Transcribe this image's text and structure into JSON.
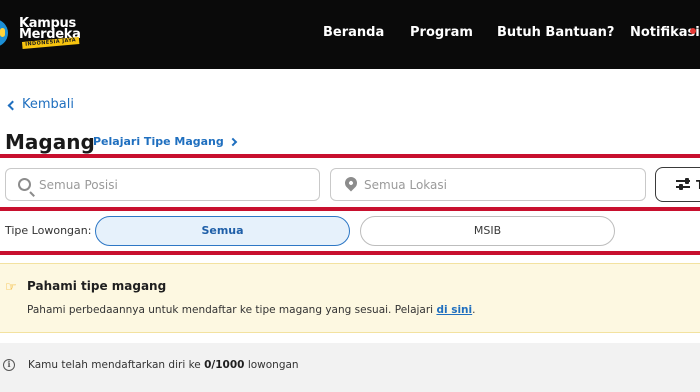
{
  "navbar": {
    "logo_line1": "Kampus",
    "logo_line2": "Merdeka",
    "logo_tagline": "INDONESIA JAYA",
    "items": [
      {
        "label": "Beranda"
      },
      {
        "label": "Program"
      },
      {
        "label": "Butuh Bantuan?"
      },
      {
        "label": "Notifikasi"
      }
    ]
  },
  "header": {
    "back_label": "Kembali",
    "title": "Magang",
    "learn_link": "Pelajari Tipe Magang"
  },
  "search": {
    "position_placeholder": "Semua Posisi",
    "position_value": "",
    "location_placeholder": "Semua Lokasi",
    "location_value": "",
    "filter_label": "T"
  },
  "type_filter": {
    "label": "Tipe Lowongan:",
    "options": [
      {
        "label": "Semua",
        "selected": true
      },
      {
        "label": "MSIB",
        "selected": false
      }
    ]
  },
  "info": {
    "icon": "pointing-hand-icon",
    "title": "Pahami tipe magang",
    "text": "Pahami perbedaannya untuk mendaftar ke tipe magang yang sesuai. Pelajari",
    "link": "di sini",
    "suffix": "."
  },
  "status": {
    "prefix": "Kamu telah mendaftarkan diri ke",
    "count": "0/1000",
    "suffix": "lowongan"
  },
  "colors": {
    "navbar_bg": "#0a0a0a",
    "accent_blue": "#1f6fbf",
    "highlight_red": "#c8102e",
    "info_bg": "#fdf8e1"
  }
}
